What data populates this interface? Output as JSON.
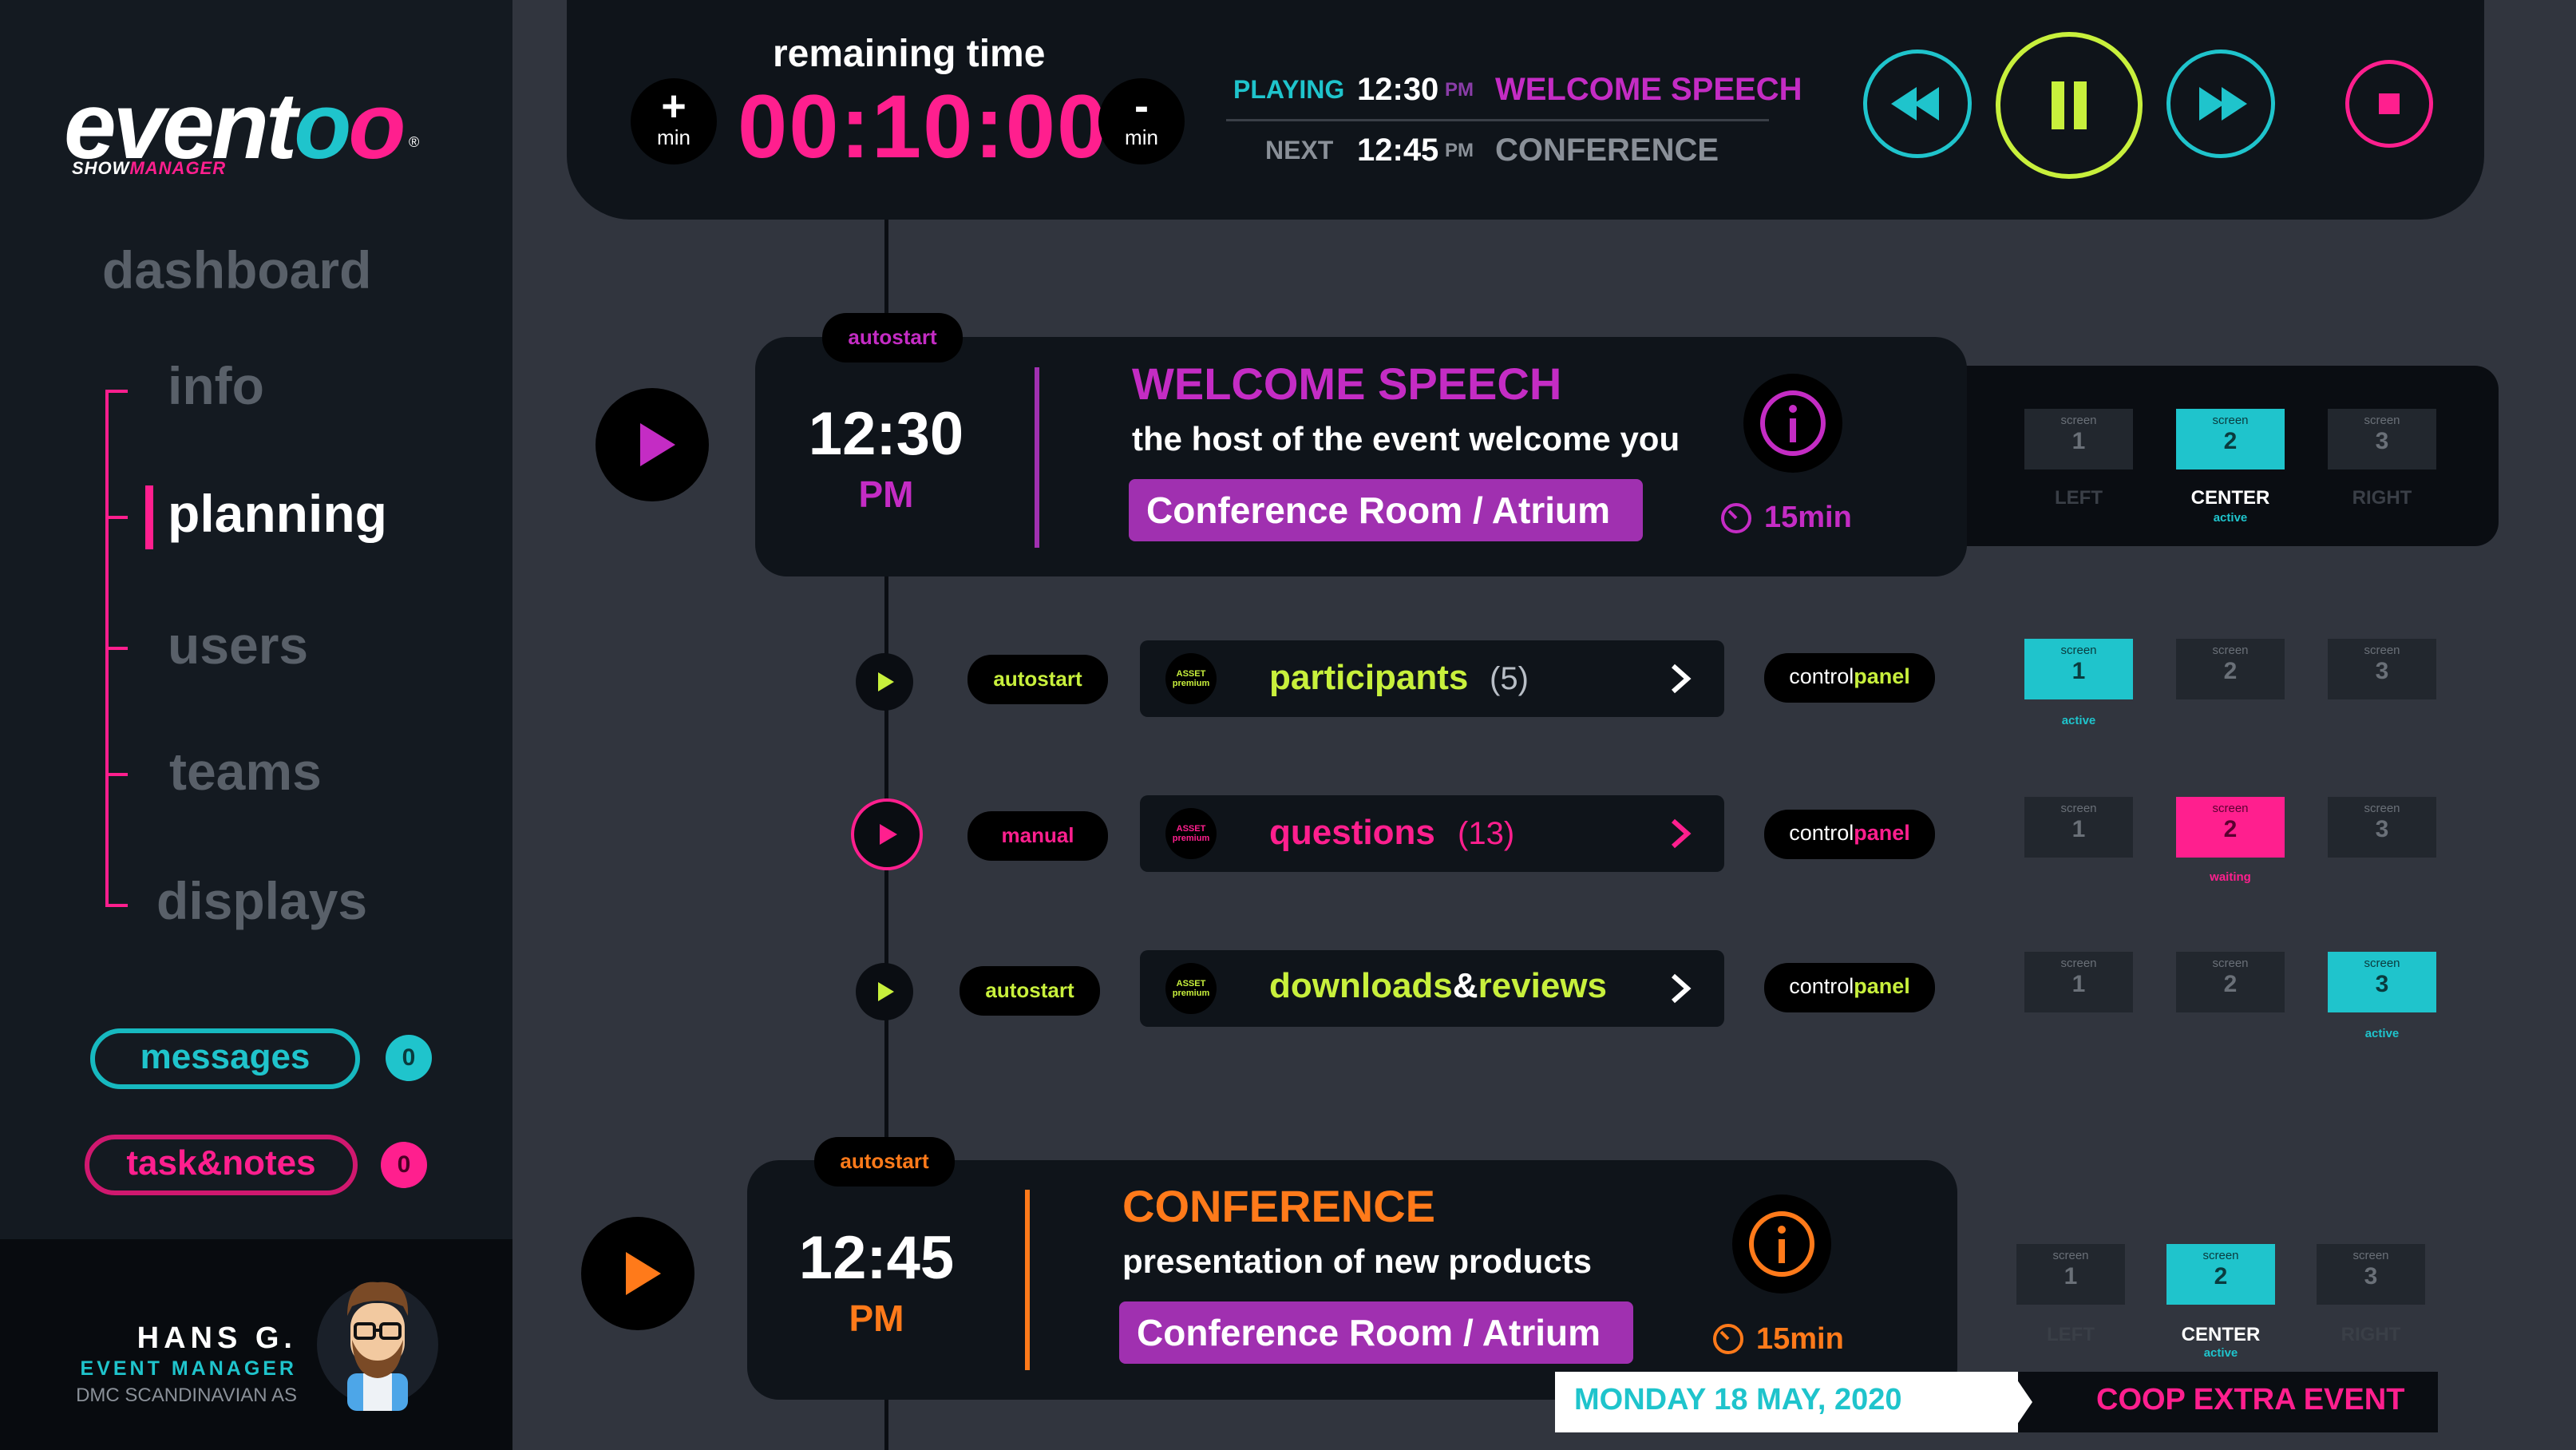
{
  "colors": {
    "cyan": "#1fc4cc",
    "magenta": "#ff1f8e",
    "lime": "#c8f03c",
    "purple": "#c42cc4",
    "orange": "#ff7a1a"
  },
  "brand": {
    "name_prefix": "event",
    "name_oo": "oo",
    "sub_show": "SHOW",
    "sub_manager": "MANAGER",
    "registered": "®"
  },
  "sidebar": {
    "items": [
      {
        "label": "dashboard"
      },
      {
        "label": "info"
      },
      {
        "label": "planning"
      },
      {
        "label": "users"
      },
      {
        "label": "teams"
      },
      {
        "label": "displays"
      }
    ],
    "messages": {
      "label": "messages",
      "count": "0"
    },
    "tasks": {
      "label": "task&notes",
      "count": "0"
    }
  },
  "user": {
    "name": "HANS G.",
    "role": "EVENT MANAGER",
    "company": "DMC SCANDINAVIAN AS",
    "avatar": "avatar-icon"
  },
  "header": {
    "remaining_label": "remaining time",
    "remaining_time": "00:10:00",
    "plus": {
      "symbol": "+",
      "label": "min"
    },
    "minus": {
      "symbol": "-",
      "label": "min"
    },
    "playing": {
      "label": "PLAYING",
      "time": "12:30",
      "ampm": "PM",
      "title": "WELCOME SPEECH"
    },
    "next": {
      "label": "NEXT",
      "time": "12:45",
      "ampm": "PM",
      "title": "CONFERENCE"
    },
    "controls": {
      "rewind": "rewind-icon",
      "pause": "pause-icon",
      "forward": "fast-forward-icon",
      "stop": "stop-icon"
    }
  },
  "events": [
    {
      "tag": "autostart",
      "time": "12:30",
      "ampm": "PM",
      "title": "WELCOME SPEECH",
      "desc": "the host of the event welcome you",
      "room": "Conference Room / Atrium",
      "duration": "15min",
      "screens": [
        {
          "lbl": "screen",
          "num": "1",
          "under": "LEFT",
          "state": "",
          "active": false
        },
        {
          "lbl": "screen",
          "num": "2",
          "under": "CENTER",
          "state": "active",
          "active": true
        },
        {
          "lbl": "screen",
          "num": "3",
          "under": "RIGHT",
          "state": "",
          "active": false
        }
      ]
    },
    {
      "tag": "autostart",
      "time": "12:45",
      "ampm": "PM",
      "title": "CONFERENCE",
      "desc": "presentation of new products",
      "room": "Conference Room / Atrium",
      "duration": "15min",
      "screens": [
        {
          "lbl": "screen",
          "num": "1",
          "under": "LEFT",
          "state": "",
          "active": false
        },
        {
          "lbl": "screen",
          "num": "2",
          "under": "CENTER",
          "state": "active",
          "active": true
        },
        {
          "lbl": "screen",
          "num": "3",
          "under": "RIGHT",
          "state": "",
          "active": false
        }
      ]
    }
  ],
  "assets": [
    {
      "mode": "autostart",
      "badge_top": "ASSET",
      "badge_bottom": "premium",
      "name": "participants",
      "count": "(5)",
      "cp_a": "control",
      "cp_b": "panel",
      "screens": [
        {
          "lbl": "screen",
          "num": "1",
          "state": "active"
        },
        {
          "lbl": "screen",
          "num": "2",
          "state": ""
        },
        {
          "lbl": "screen",
          "num": "3",
          "state": ""
        }
      ]
    },
    {
      "mode": "manual",
      "badge_top": "ASSET",
      "badge_bottom": "premium",
      "name": "questions",
      "count": "(13)",
      "cp_a": "control",
      "cp_b": "panel",
      "screens": [
        {
          "lbl": "screen",
          "num": "1",
          "state": ""
        },
        {
          "lbl": "screen",
          "num": "2",
          "state": "waiting"
        },
        {
          "lbl": "screen",
          "num": "3",
          "state": ""
        }
      ]
    },
    {
      "mode": "autostart",
      "badge_top": "ASSET",
      "badge_bottom": "premium",
      "name_a": "downloads",
      "name_amp": "&",
      "name_b": "reviews",
      "cp_a": "control",
      "cp_b": "panel",
      "screens": [
        {
          "lbl": "screen",
          "num": "1",
          "state": ""
        },
        {
          "lbl": "screen",
          "num": "2",
          "state": ""
        },
        {
          "lbl": "screen",
          "num": "3",
          "state": "active"
        }
      ]
    }
  ],
  "footer": {
    "date": "MONDAY 18 MAY, 2020",
    "event": "COOP EXTRA EVENT"
  }
}
